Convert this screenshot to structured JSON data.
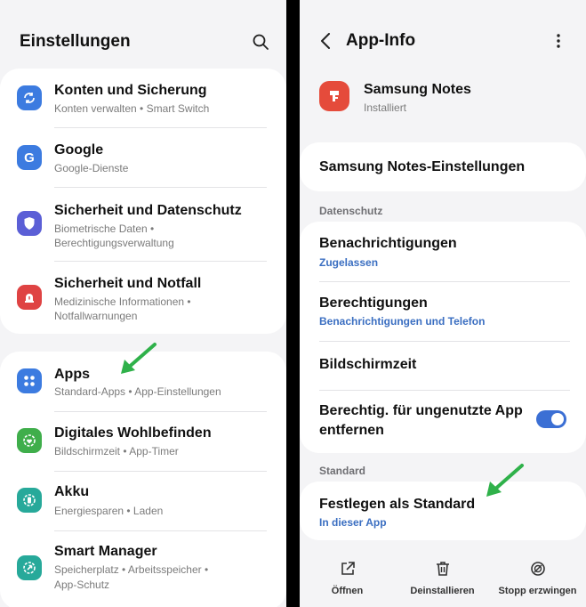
{
  "left": {
    "title": "Einstellungen",
    "items": [
      {
        "title": "Konten und Sicherung",
        "sub": "Konten verwalten  •  Smart Switch",
        "icon": "sync-icon",
        "color": "#3c7be0"
      },
      {
        "title": "Google",
        "sub": "Google-Dienste",
        "icon": "google-icon",
        "color": "#3c7be0"
      },
      {
        "title": "Sicherheit und Datenschutz",
        "sub": "Biometrische Daten  •",
        "sub2": "Berechtigungsverwaltung",
        "icon": "shield-icon",
        "color": "#5b5fd6"
      },
      {
        "title": "Sicherheit und Notfall",
        "sub": "Medizinische Informationen  •",
        "sub2": "Notfallwarnungen",
        "icon": "emergency-icon",
        "color": "#df4343"
      },
      {
        "title": "Apps",
        "sub": "Standard-Apps  •  App-Einstellungen",
        "icon": "apps-grid-icon",
        "color": "#3c7be0"
      },
      {
        "title": "Digitales Wohlbefinden",
        "sub": "Bildschirmzeit  •  App-Timer",
        "icon": "wellbeing-icon",
        "color": "#3fae4b"
      },
      {
        "title": "Akku",
        "sub": "Energiesparen  •  Laden",
        "icon": "battery-icon",
        "color": "#27a99a"
      },
      {
        "title": "Smart Manager",
        "sub": "Speicherplatz  •  Arbeitsspeicher  •",
        "sub2": "App-Schutz",
        "icon": "smart-manager-icon",
        "color": "#27a99a"
      }
    ]
  },
  "right": {
    "title": "App-Info",
    "app_name": "Samsung Notes",
    "app_status": "Installiert",
    "app_color": "#e54b3b",
    "settings_row": "Samsung Notes-Einstellungen",
    "section_privacy": "Datenschutz",
    "notifications_title": "Benachrichtigungen",
    "notifications_value": "Zugelassen",
    "permissions_title": "Berechtigungen",
    "permissions_value": "Benachrichtigungen und Telefon",
    "screen_time": "Bildschirmzeit",
    "unused_line1": "Berechtig. für ungenutzte App",
    "unused_line2": "entfernen",
    "unused_toggle_on": true,
    "section_standard": "Standard",
    "default_title": "Festlegen als Standard",
    "default_value": "In dieser App",
    "bottom": {
      "open": "Öffnen",
      "uninstall": "Deinstallieren",
      "force_stop": "Stopp erzwingen"
    }
  },
  "colors": {
    "accent": "#3b6fd4",
    "arrow": "#2fb14a"
  }
}
